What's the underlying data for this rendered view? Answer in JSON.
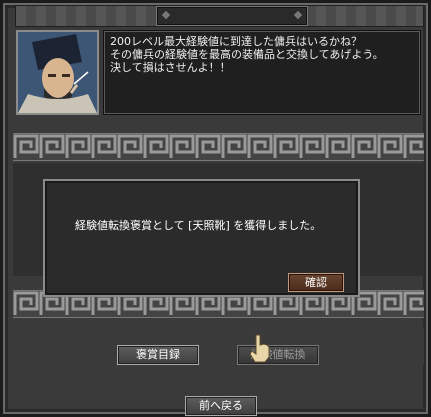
{
  "window": {
    "title_tab_label": ""
  },
  "npc": {
    "portrait_icon": "npc-portrait",
    "dialogue_lines": [
      "200レベル最大経験値に到達した傭兵はいるかね？",
      "その傭兵の経験値を最高の装備品と交換してあげよう。",
      "決して損はさせんよ！！"
    ]
  },
  "modal": {
    "message": "経験値転換褒賞として [天照靴] を獲得しました。",
    "confirm_label": "確認"
  },
  "buttons": {
    "reward_list": "褒賞目録",
    "exp_convert": "経験値転換",
    "back": "前へ戻る"
  },
  "colors": {
    "frame": "#3a3a3a",
    "dialog_bg": "#1f1f1f",
    "confirm_accent": "#6a4430"
  }
}
